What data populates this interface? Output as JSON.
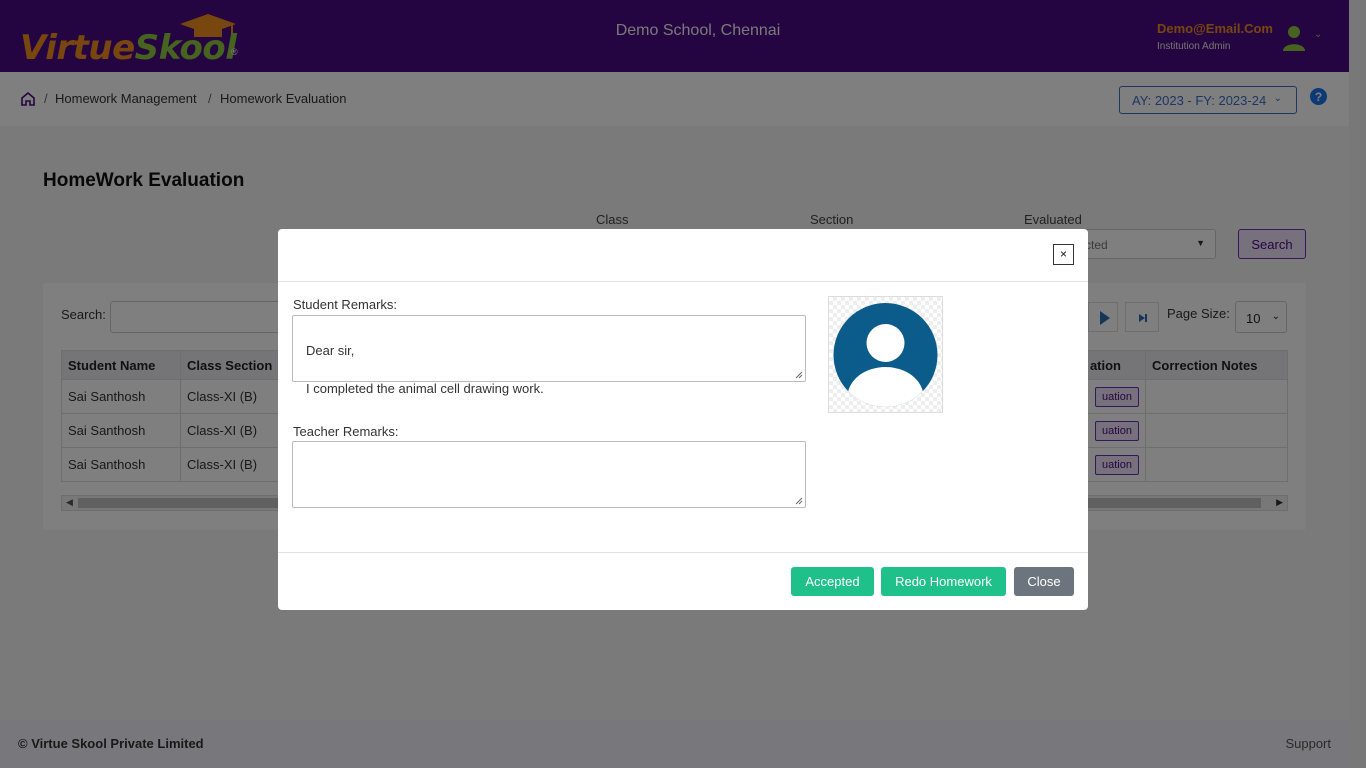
{
  "header": {
    "logo_text_a": "Virtue",
    "logo_text_b": "Skool",
    "logo_reg": "®",
    "school_name": "Demo School, Chennai",
    "user_email": "Demo@Email.Com",
    "user_role": "Institution Admin"
  },
  "breadcrumb": {
    "items": [
      "Homework Management",
      "Homework Evaluation"
    ],
    "separator": "/"
  },
  "year_select": {
    "value": "AY: 2023 - FY: 2023-24"
  },
  "page": {
    "title": "HomeWork Evaluation"
  },
  "filters": {
    "class_label": "Class",
    "section_label": "Section",
    "evaluated_label": "Evaluated",
    "evaluated_value": "cted",
    "search_button": "Search"
  },
  "table": {
    "search_label": "Search:",
    "page_size_label": "Page Size:",
    "page_size_value": "10",
    "columns": [
      "Student Name",
      "Class Section",
      "ation",
      "Correction Notes"
    ],
    "rows": [
      {
        "student": "Sai Santhosh",
        "class_section": "Class-XI (B)",
        "action": "uation",
        "notes": ""
      },
      {
        "student": "Sai Santhosh",
        "class_section": "Class-XI (B)",
        "action": "uation",
        "notes": ""
      },
      {
        "student": "Sai Santhosh",
        "class_section": "Class-XI (B)",
        "action": "uation",
        "notes": ""
      }
    ]
  },
  "footer": {
    "copyright": "© Virtue Skool Private Limited",
    "support": "Support"
  },
  "modal": {
    "close_x": "×",
    "student_remarks_label": "Student Remarks:",
    "student_remarks_value": "Dear sir,\n\nI completed the animal cell drawing work.",
    "teacher_remarks_label": "Teacher Remarks:",
    "teacher_remarks_value": "",
    "accepted_button": "Accepted",
    "redo_button": "Redo Homework",
    "close_button": "Close"
  },
  "colors": {
    "header_bg": "#4b0a82",
    "accent_orange": "#f08c1e",
    "accent_green": "#8cc63f",
    "success": "#20c08a",
    "secondary": "#6c757d",
    "link_blue": "#3a6dc9",
    "avatar_blue": "#0b5c8a"
  },
  "icons": [
    "home-icon",
    "help-icon",
    "user-avatar-icon",
    "chevron-down-icon",
    "close-icon",
    "play-next-icon",
    "skip-last-icon",
    "profile-placeholder-icon"
  ]
}
